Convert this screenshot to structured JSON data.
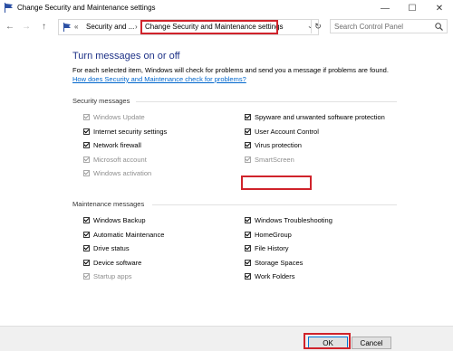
{
  "window": {
    "title": "Change Security and Maintenance settings",
    "minimize": "—",
    "maximize": "☐",
    "close": "✕"
  },
  "nav": {
    "back": "←",
    "forward": "→",
    "up": "↑",
    "breadcrumb_sep": "«",
    "chevron": "›",
    "dropdown": "⌄",
    "refresh": "↻"
  },
  "address": {
    "crumb1": "Security and ...",
    "crumb2": "Change Security and Maintenance settings"
  },
  "search": {
    "placeholder": "Search Control Panel"
  },
  "page": {
    "heading": "Turn messages on or off",
    "description": "For each selected item, Windows will check for problems and send you a message if problems are found.",
    "link": "How does Security and Maintenance check for problems?"
  },
  "security": {
    "title": "Security messages",
    "left": [
      {
        "label": "Windows Update",
        "checked": true,
        "disabled": true
      },
      {
        "label": "Internet security settings",
        "checked": true,
        "disabled": false
      },
      {
        "label": "Network firewall",
        "checked": true,
        "disabled": false
      },
      {
        "label": "Microsoft account",
        "checked": true,
        "disabled": true
      },
      {
        "label": "Windows activation",
        "checked": true,
        "disabled": true
      }
    ],
    "right": [
      {
        "label": "Spyware and unwanted software protection",
        "checked": true,
        "disabled": false
      },
      {
        "label": "User Account Control",
        "checked": true,
        "disabled": false
      },
      {
        "label": "Virus protection",
        "checked": true,
        "disabled": false
      },
      {
        "label": "SmartScreen",
        "checked": true,
        "disabled": true
      }
    ]
  },
  "maintenance": {
    "title": "Maintenance messages",
    "left": [
      {
        "label": "Windows Backup",
        "checked": true,
        "disabled": false
      },
      {
        "label": "Automatic Maintenance",
        "checked": true,
        "disabled": false
      },
      {
        "label": "Drive status",
        "checked": true,
        "disabled": false
      },
      {
        "label": "Device software",
        "checked": true,
        "disabled": false
      },
      {
        "label": "Startup apps",
        "checked": true,
        "disabled": true
      }
    ],
    "right": [
      {
        "label": "Windows Troubleshooting",
        "checked": true,
        "disabled": false
      },
      {
        "label": "HomeGroup",
        "checked": true,
        "disabled": false
      },
      {
        "label": "File History",
        "checked": true,
        "disabled": false
      },
      {
        "label": "Storage Spaces",
        "checked": true,
        "disabled": false
      },
      {
        "label": "Work Folders",
        "checked": true,
        "disabled": false
      }
    ]
  },
  "buttons": {
    "ok": "OK",
    "cancel": "Cancel"
  },
  "colors": {
    "highlight": "#d0232b",
    "heading": "#1e3287",
    "link": "#0066cc"
  }
}
